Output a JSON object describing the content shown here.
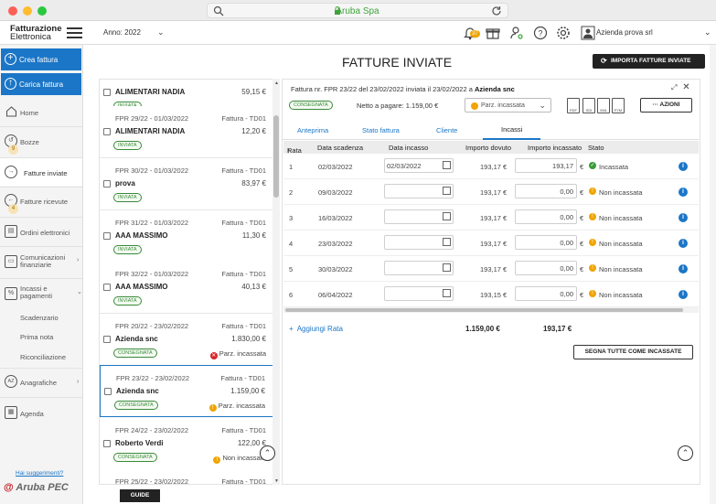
{
  "browser": {
    "url_title": "Aruba Spa"
  },
  "header": {
    "brand_line1": "Fatturazione",
    "brand_line2": "Elettronica",
    "year_label": "Anno: 2022",
    "notification_count": "37",
    "company": "Azienda prova srl"
  },
  "sidebar": {
    "create_label": "Crea fattura",
    "upload_label": "Carica fattura",
    "items": [
      {
        "label": "Home"
      },
      {
        "label": "Bozze",
        "count": "9"
      },
      {
        "label": "Fatture inviate"
      },
      {
        "label": "Fatture ricevute",
        "count": "4"
      },
      {
        "label": "Ordini elettronici"
      },
      {
        "label": "Comunicazioni finanziarie"
      },
      {
        "label": "Incassi e pagamenti"
      },
      {
        "label": "Scadenzario"
      },
      {
        "label": "Prima nota"
      },
      {
        "label": "Riconciliazione"
      },
      {
        "label": "Anagrafiche"
      },
      {
        "label": "Agenda"
      }
    ],
    "suggestion_link": "Hai suggerimenti?",
    "footer_brand": "Aruba PEC"
  },
  "page": {
    "title": "FATTURE INVIATE",
    "import_label": "IMPORTA FATTURE INVIATE",
    "guide_label": "GUIDE"
  },
  "invoices": [
    {
      "ref": "",
      "doc": "",
      "name": "ALIMENTARI NADIA",
      "amount": "59,15 €",
      "pill": "INVIATA",
      "status": ""
    },
    {
      "ref": "FPR 29/22 - 01/03/2022",
      "doc": "Fattura - TD01",
      "name": "ALIMENTARI NADIA",
      "amount": "12,20 €",
      "pill": "INVIATA",
      "status": ""
    },
    {
      "ref": "FPR 30/22 - 01/03/2022",
      "doc": "Fattura - TD01",
      "name": "prova",
      "amount": "83,97 €",
      "pill": "INVIATA",
      "status": ""
    },
    {
      "ref": "FPR 31/22 - 01/03/2022",
      "doc": "Fattura - TD01",
      "name": "AAA MASSIMO",
      "amount": "11,30 €",
      "pill": "INVIATA",
      "status": ""
    },
    {
      "ref": "FPR 32/22 - 01/03/2022",
      "doc": "Fattura - TD01",
      "name": "AAA MASSIMO",
      "amount": "40,13 €",
      "pill": "INVIATA",
      "status": ""
    },
    {
      "ref": "FPR 20/22 - 23/02/2022",
      "doc": "Fattura - TD01",
      "name": "Azienda snc",
      "amount": "1.830,00 €",
      "pill": "CONSEGNATA",
      "status": "Parz. incassata",
      "status_color": "#d9262c",
      "status_glyph": "✕"
    },
    {
      "ref": "FPR 23/22 - 23/02/2022",
      "doc": "Fattura - TD01",
      "name": "Azienda snc",
      "amount": "1.159,00 €",
      "pill": "CONSEGNATA",
      "status": "Parz. incassata",
      "status_color": "#f0a500",
      "status_glyph": "!"
    },
    {
      "ref": "FPR 24/22 - 23/02/2022",
      "doc": "Fattura - TD01",
      "name": "Roberto Verdi",
      "amount": "122,00 €",
      "pill": "CONSEGNATA",
      "status": "Non incassata",
      "status_color": "#f0a500",
      "status_glyph": "!"
    },
    {
      "ref": "FPR 25/22 - 23/02/2022",
      "doc": "Fattura - TD01",
      "name": "",
      "amount": "",
      "pill": "",
      "status": ""
    }
  ],
  "detail": {
    "header_prefix": "Fattura nr. FPR 23/22 del 23/02/2022 inviata il 23/02/2022 a",
    "header_client": "Azienda snc",
    "state_pill": "CONSEGNATA",
    "net_due": "Netto a pagare: 1.159,00 €",
    "payment_status": "Parz. incassata",
    "file_icons": [
      "PDF",
      "SDI",
      "XML",
      "P7M"
    ],
    "actions_label": "··· AZIONI",
    "tabs": [
      "Anteprima",
      "Stato fattura",
      "Cliente",
      "Incassi"
    ],
    "columns": [
      "Rata",
      "Data scadenza",
      "Data incasso",
      "Importo dovuto",
      "Importo incassato",
      "Stato"
    ],
    "rows": [
      {
        "rata": "1",
        "scadenza": "02/03/2022",
        "incasso": "02/03/2022",
        "dovuto": "193,17 €",
        "incassato": "193,17",
        "stato": "Incassata",
        "stato_color": "#3a9a3a",
        "stato_glyph": "✓"
      },
      {
        "rata": "2",
        "scadenza": "09/03/2022",
        "incasso": "",
        "dovuto": "193,17 €",
        "incassato": "0,00",
        "stato": "Non incassata",
        "stato_color": "#f0a500",
        "stato_glyph": "!"
      },
      {
        "rata": "3",
        "scadenza": "16/03/2022",
        "incasso": "",
        "dovuto": "193,17 €",
        "incassato": "0,00",
        "stato": "Non incassata",
        "stato_color": "#f0a500",
        "stato_glyph": "!"
      },
      {
        "rata": "4",
        "scadenza": "23/03/2022",
        "incasso": "",
        "dovuto": "193,17 €",
        "incassato": "0,00",
        "stato": "Non incassata",
        "stato_color": "#f0a500",
        "stato_glyph": "!"
      },
      {
        "rata": "5",
        "scadenza": "30/03/2022",
        "incasso": "",
        "dovuto": "193,17 €",
        "incassato": "0,00",
        "stato": "Non incassata",
        "stato_color": "#f0a500",
        "stato_glyph": "!"
      },
      {
        "rata": "6",
        "scadenza": "06/04/2022",
        "incasso": "",
        "dovuto": "193,15 €",
        "incassato": "0,00",
        "stato": "Non incassata",
        "stato_color": "#f0a500",
        "stato_glyph": "!"
      }
    ],
    "currency_symbol": "€",
    "add_rata": "Aggiungi Rata",
    "total_due": "1.159,00 €",
    "total_collected": "193,17 €",
    "mark_all_label": "SEGNA TUTTE COME INCASSATE"
  }
}
